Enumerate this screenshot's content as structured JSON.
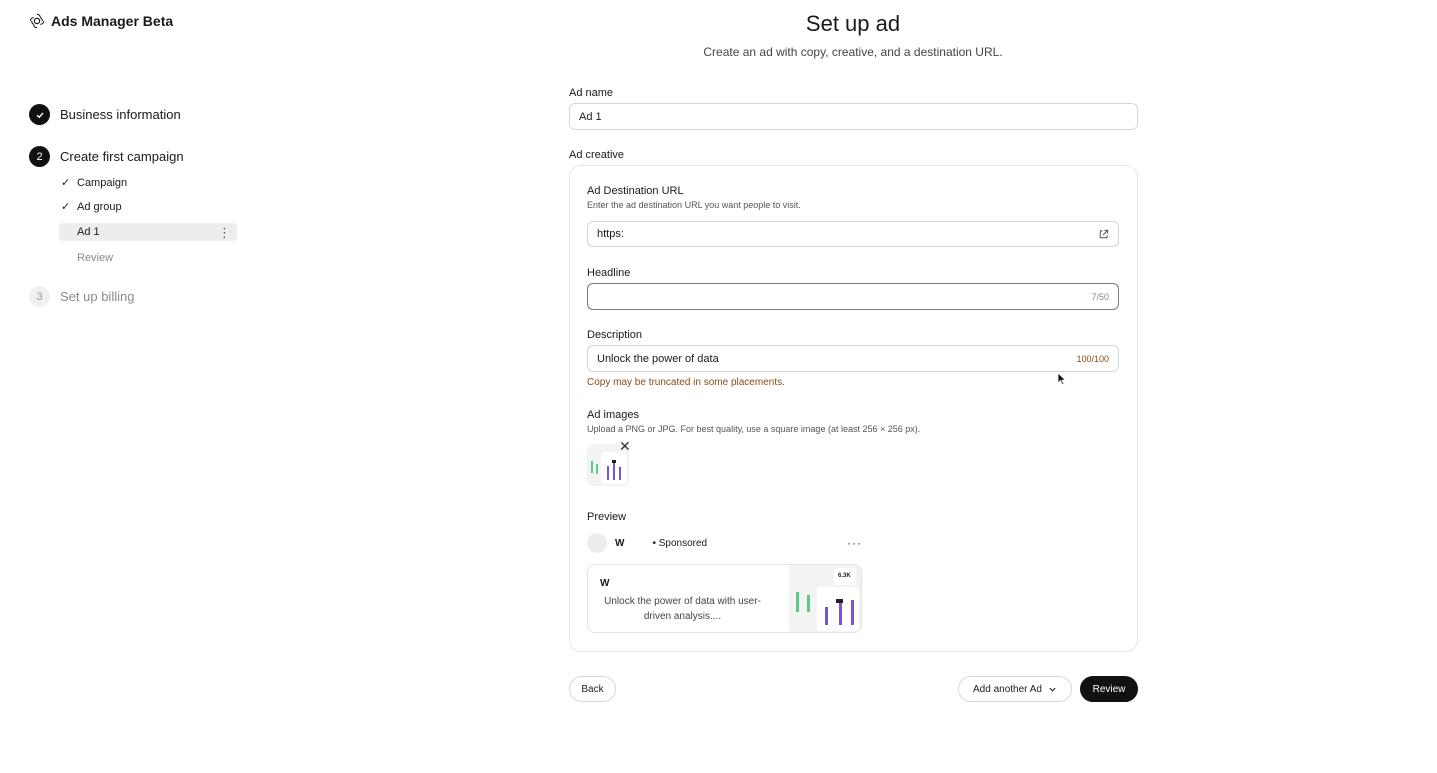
{
  "brand": {
    "name": "Ads Manager Beta"
  },
  "sidebar": {
    "steps": [
      {
        "number": "",
        "label": "Business information",
        "state": "done"
      },
      {
        "number": "2",
        "label": "Create first campaign",
        "state": "current"
      },
      {
        "number": "3",
        "label": "Set up billing",
        "state": "pending"
      }
    ],
    "substeps": [
      {
        "label": "Campaign",
        "state": "done"
      },
      {
        "label": "Ad group",
        "state": "done"
      },
      {
        "label": "Ad 1",
        "state": "active"
      },
      {
        "label": "Review",
        "state": "pending"
      }
    ],
    "check_glyph": "✓",
    "kebab_glyph": "⋮"
  },
  "header": {
    "title": "Set up ad",
    "subtitle": "Create an ad with copy, creative, and a destination URL."
  },
  "form": {
    "ad_name": {
      "label": "Ad name",
      "value": "Ad 1"
    },
    "ad_creative_label": "Ad creative",
    "destination": {
      "label": "Ad Destination URL",
      "help": "Enter the ad destination URL you want people to visit.",
      "value": "https:"
    },
    "headline": {
      "label": "Headline",
      "value": "",
      "counter": "7/50"
    },
    "description": {
      "label": "Description",
      "value": "Unlock the power of data",
      "counter": "100/100",
      "warning": "Copy may be truncated in some placements."
    },
    "images": {
      "label": "Ad images",
      "help": "Upload a PNG or JPG. For best quality, use a square image (at least 256 × 256 px).",
      "remove_glyph": "✕"
    }
  },
  "preview": {
    "label": "Preview",
    "advertiser": "W",
    "sponsored": "• Sponsored",
    "more_glyph": "···",
    "card_title": "W",
    "card_description": "Unlock the power of data with user-driven analysis....",
    "image_badge": "6.3K"
  },
  "buttons": {
    "back": "Back",
    "add_another": "Add another Ad",
    "review": "Review"
  },
  "colors": {
    "primary": "#111111",
    "warning": "#8a4a1a",
    "chart_green": "#5cc98a",
    "chart_purple": "#7a55c9"
  }
}
